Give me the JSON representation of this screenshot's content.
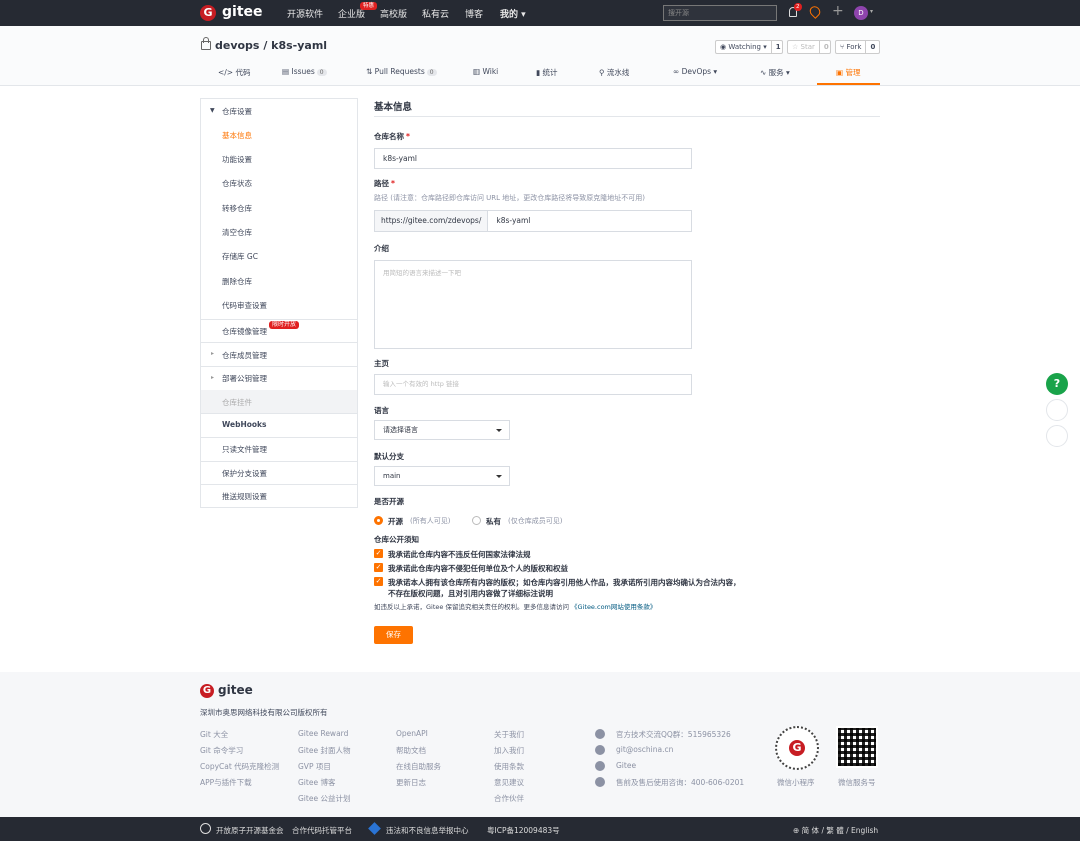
{
  "topnav": {
    "brand": "gitee",
    "logo_letter": "G",
    "links": [
      "开源软件",
      "企业版",
      "高校版",
      "私有云",
      "博客",
      "我的"
    ],
    "enterprise_badge": "特惠",
    "search_placeholder": "搜开源",
    "notify_count": "2",
    "avatar_letter": "D"
  },
  "repo": {
    "title": "devops / k8s-yaml",
    "watch_label": "Watching",
    "watch_count": "1",
    "star_label": "Star",
    "star_count": "0",
    "fork_label": "Fork",
    "fork_count": "0",
    "tabs": [
      {
        "label": "代码"
      },
      {
        "label": "Issues",
        "count": "0"
      },
      {
        "label": "Pull Requests",
        "count": "0"
      },
      {
        "label": "Wiki"
      },
      {
        "label": "统计"
      },
      {
        "label": "流水线"
      },
      {
        "label": "DevOps"
      },
      {
        "label": "服务"
      },
      {
        "label": "管理"
      }
    ]
  },
  "sidebar": {
    "group_title": "仓库设置",
    "items": [
      "基本信息",
      "功能设置",
      "仓库状态",
      "转移仓库",
      "清空仓库",
      "存储库 GC",
      "删除仓库",
      "代码审查设置"
    ],
    "mirror": "仓库镜像管理",
    "mirror_badge": "限时开放",
    "members": "仓库成员管理",
    "deploy_keys": "部署公钥管理",
    "plugins": "仓库挂件",
    "webhooks": "WebHooks",
    "readonly": "只读文件管理",
    "protect": "保护分支设置",
    "push_rules": "推送规则设置"
  },
  "form": {
    "heading": "基本信息",
    "name_label": "仓库名称",
    "name_value": "k8s-yaml",
    "path_label": "路径",
    "path_hint": "路径 (请注意：仓库路径即仓库访问 URL 地址，更改仓库路径将导致原克隆地址不可用)",
    "path_prefix": "https://gitee.com/zdevops/",
    "path_value": "k8s-yaml",
    "intro_label": "介绍",
    "intro_placeholder": "用简短的语言来描述一下吧",
    "homepage_label": "主页",
    "homepage_placeholder": "输入一个有效的 http 链接",
    "lang_label": "语言",
    "lang_value": "请选择语言",
    "branch_label": "默认分支",
    "branch_value": "main",
    "open_label": "是否开源",
    "open_option": "开源",
    "open_hint": "(所有人可见)",
    "private_option": "私有",
    "private_hint": "(仅仓库成员可见)",
    "notice_label": "仓库公开须知",
    "check1": "我承诺此仓库内容不违反任何国家法律法规",
    "check2": "我承诺此仓库内容不侵犯任何单位及个人的版权和权益",
    "check3a": "我承诺本人拥有该仓库所有内容的版权；如仓库内容引用他人作品，我承诺所引用内容均确认为合法内容，",
    "check3b": "不存在版权问题，且对引用内容做了详细标注说明",
    "disclaimer": "如违反以上承诺，Gitee 保留追究相关责任的权利。更多信息请访问",
    "disclaimer_link": "《Gitee.com网站使用条款》",
    "save": "保存"
  },
  "footer": {
    "brand": "gitee",
    "copyright": "深圳市奥思网络科技有限公司版权所有",
    "col1": [
      "Git 大全",
      "Git 命令学习",
      "CopyCat 代码克隆检测",
      "APP与插件下载"
    ],
    "col2": [
      "Gitee Reward",
      "Gitee 封面人物",
      "GVP 项目",
      "Gitee 博客",
      "Gitee 公益计划"
    ],
    "col3": [
      "OpenAPI",
      "帮助文档",
      "在线自助服务",
      "更新日志"
    ],
    "col4": [
      "关于我们",
      "加入我们",
      "使用条款",
      "意见建议",
      "合作伙伴"
    ],
    "contacts": [
      "官方技术交流QQ群：515965326",
      "git@oschina.cn",
      "Gitee",
      "售前及售后使用咨询：400-606-0201"
    ],
    "qr1_label": "微信小程序",
    "qr2_label": "微信服务号"
  },
  "bottombar": {
    "foundation": "开放原子开源基金会",
    "platform": "合作代码托管平台",
    "report": "违法和不良信息举报中心",
    "icp": "粤ICP备12009483号",
    "lang": "简 体 / 繁 體 / English"
  },
  "floating": {
    "help": "?"
  },
  "colors": {
    "accent": "#fe7300",
    "nav": "#262a33",
    "brand": "#c71d23",
    "link": "#005980",
    "help": "#19a34a"
  }
}
